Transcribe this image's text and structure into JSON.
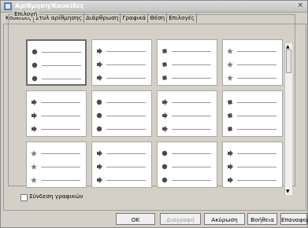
{
  "window": {
    "title": "Αρίθμηση/Κουκίδες"
  },
  "tabs": [
    {
      "label": "Κουκίδες"
    },
    {
      "label": "Στυλ αρίθμησης"
    },
    {
      "label": "Διάρθρωση"
    },
    {
      "label": "Γραφικά"
    },
    {
      "label": "Θέση"
    },
    {
      "label": "Επιλογές"
    }
  ],
  "group": {
    "label": "Επιλογή"
  },
  "grid": {
    "rows": [
      [
        "ball",
        "arrow",
        "square",
        "star"
      ],
      [
        "arrow",
        "ball",
        "arrow",
        "square"
      ],
      [
        "star",
        "arrow",
        "ball",
        "arrow"
      ]
    ]
  },
  "checkbox": {
    "label": "Σύνδεση γραφικών",
    "checked": false
  },
  "buttons": {
    "ok": "OK",
    "apply": "Διαγραφή",
    "cancel": "Ακύρωση",
    "help": "Βοήθεια",
    "reset": "Επαναφορά"
  }
}
